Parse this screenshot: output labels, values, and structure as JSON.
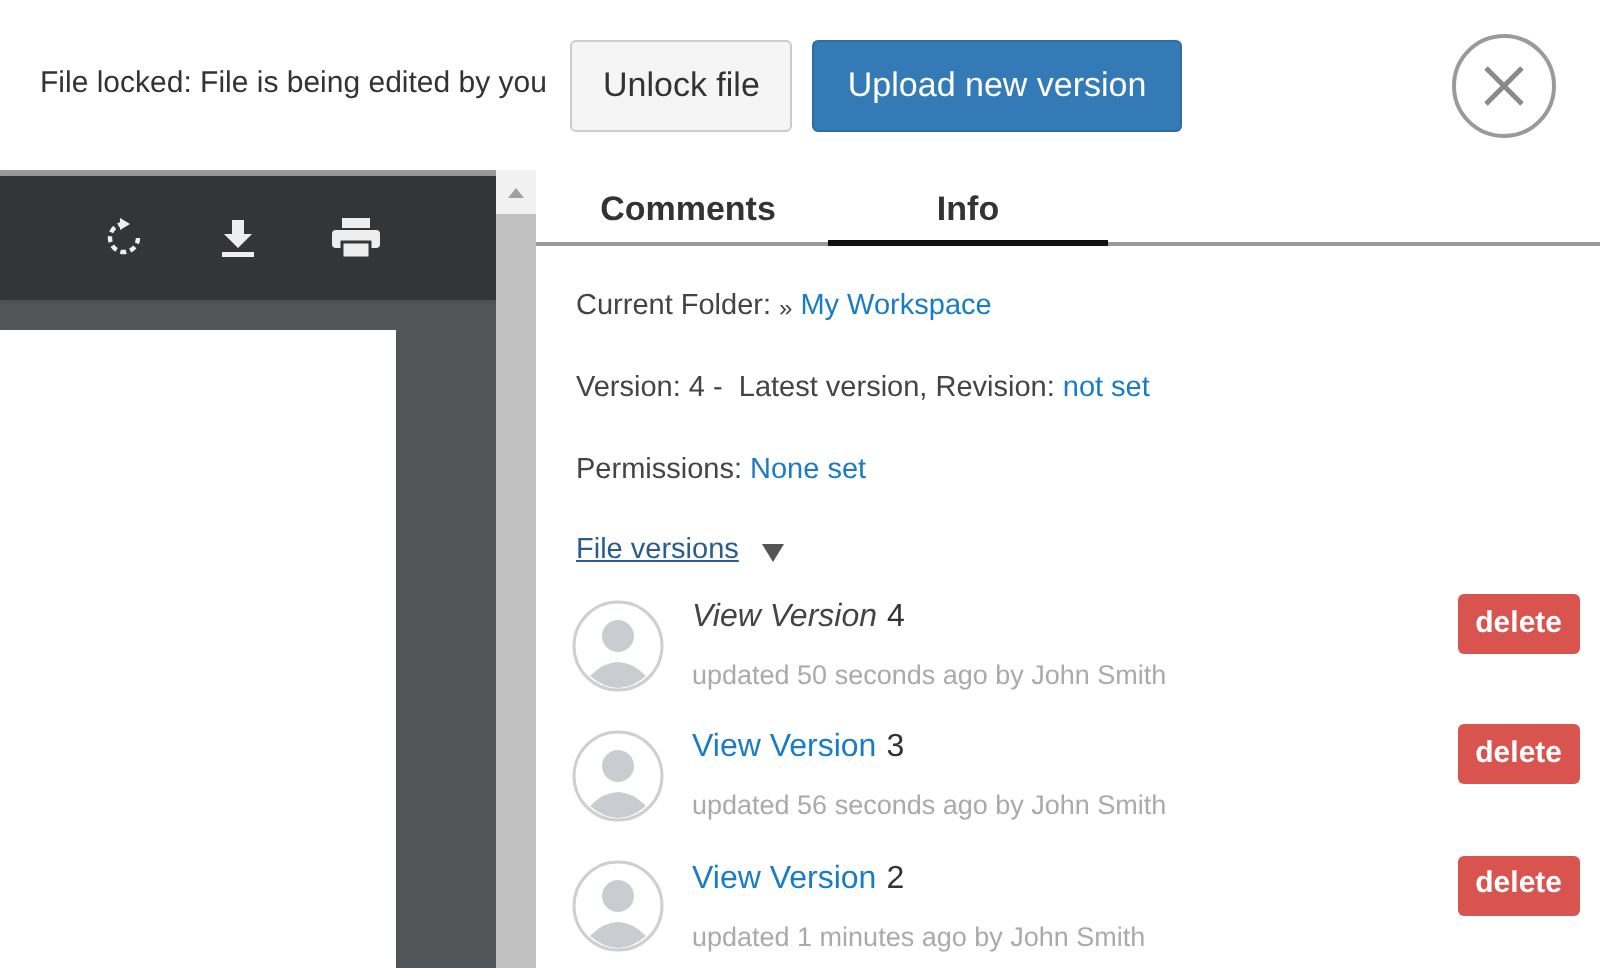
{
  "lock_bar": {
    "message": "File locked: File is being edited by you",
    "buttons": [
      {
        "label": "Unlock file",
        "kind": "default"
      },
      {
        "label": "Upload new version",
        "kind": "primary"
      }
    ]
  },
  "tabs": [
    {
      "label": "Comments",
      "selected": false
    },
    {
      "label": "Info",
      "selected": true
    }
  ],
  "info": {
    "folder": {
      "label": "Current Folder:",
      "separator": "»",
      "link": "My Workspace"
    },
    "version": {
      "label": "Version: 4 -  Latest version, Revision:",
      "link": "not set"
    },
    "permissions": {
      "label": "Permissions:",
      "link": "None set"
    },
    "file_versions": {
      "label": "File versions",
      "expanded": true
    }
  },
  "versions": [
    {
      "link": "View Version",
      "number": "4",
      "current": true,
      "meta": "updated 50 seconds ago by John Smith",
      "action": "delete"
    },
    {
      "link": "View Version",
      "number": "3",
      "current": false,
      "meta": "updated 56 seconds ago by John Smith",
      "action": "delete"
    },
    {
      "link": "View Version",
      "number": "2",
      "current": false,
      "meta": "updated 1 minutes ago by John Smith",
      "action": "delete"
    }
  ]
}
